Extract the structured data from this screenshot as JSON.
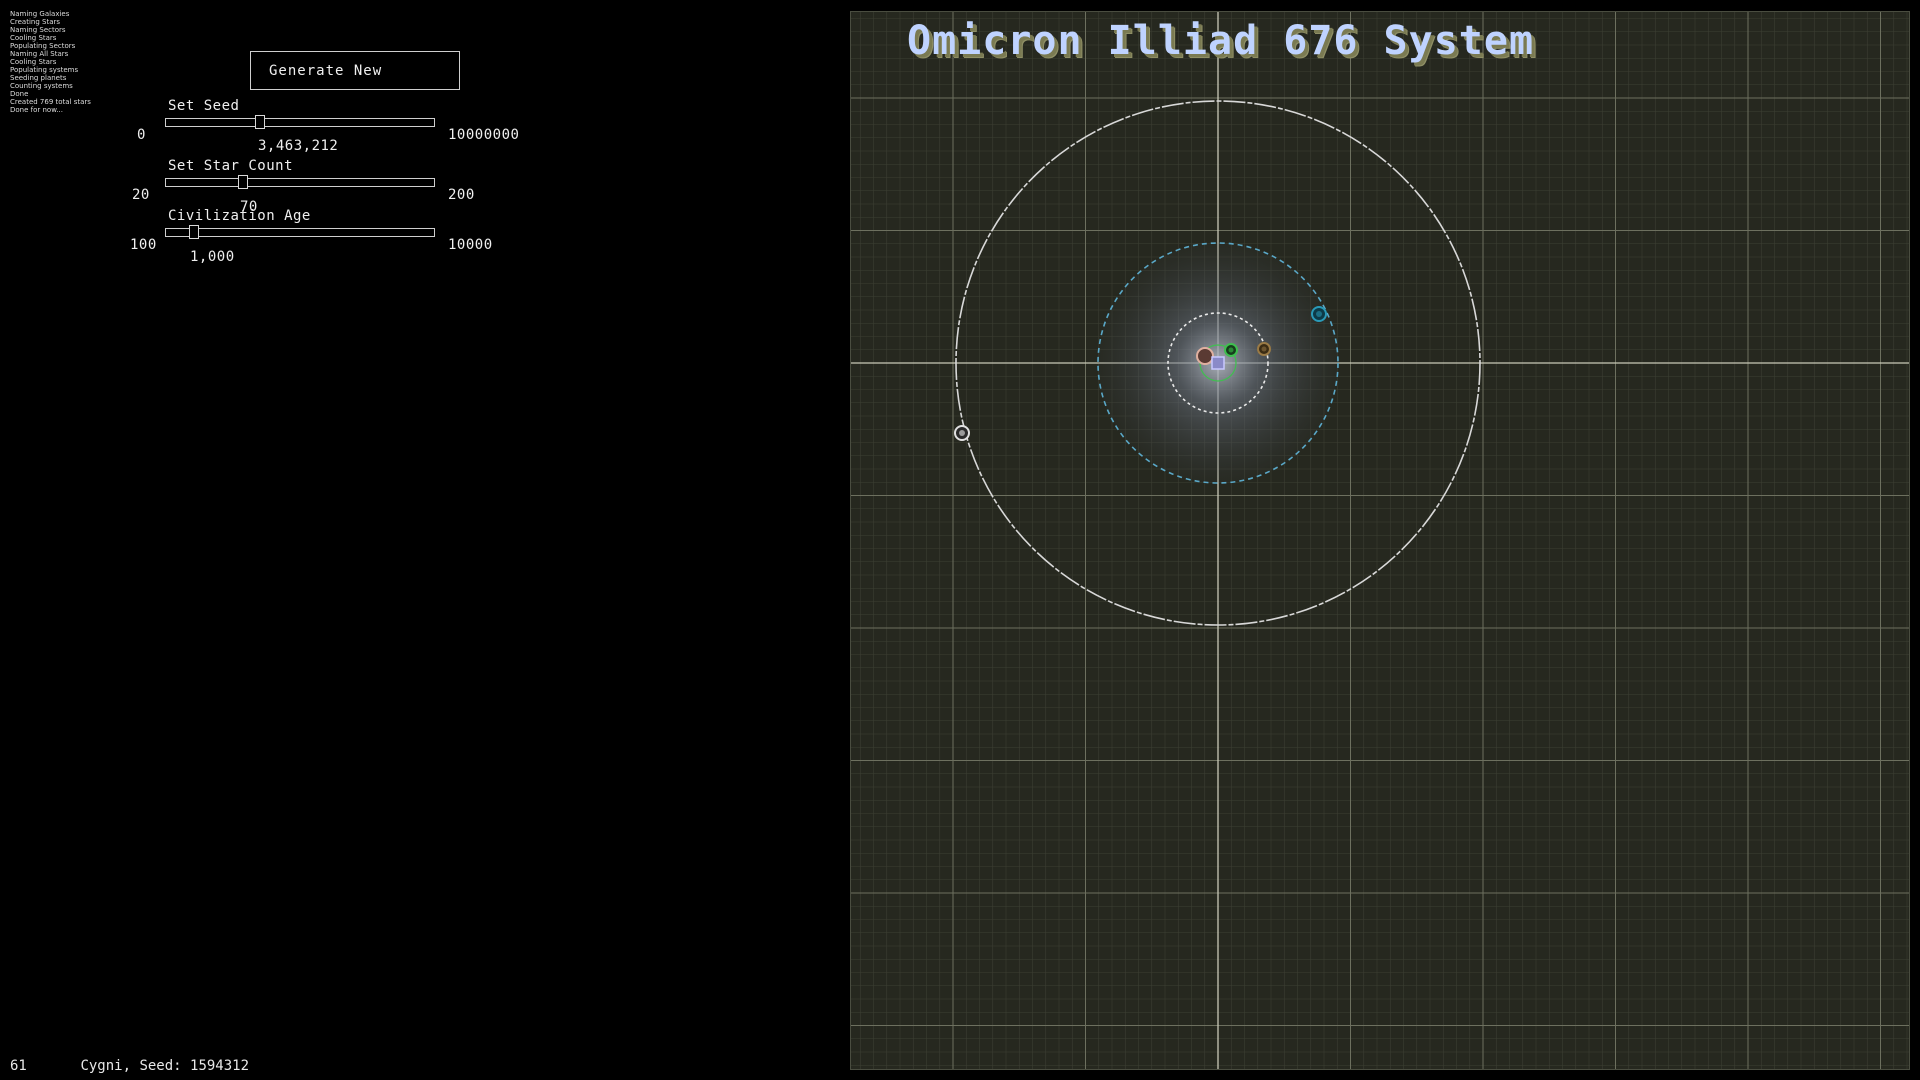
{
  "log": [
    "Naming Galaxies",
    "Creating Stars",
    "Naming Sectors",
    "Cooling Stars",
    "Populating Sectors",
    "Naming All Stars",
    "Cooling Stars",
    "Populating systems",
    "Seeding planets",
    "Counting systems",
    "Done",
    "Created 769 total stars",
    "Done for now..."
  ],
  "generate_button": "Generate New",
  "seed": {
    "label": "Set Seed",
    "min": "0",
    "max": "10000000",
    "value": "3,463,212",
    "fraction": 0.346
  },
  "star_count": {
    "label": "Set Star Count",
    "min": "20",
    "max": "200",
    "value": "70",
    "fraction": 0.278
  },
  "civ_age": {
    "label": "Civilization Age",
    "min": "100",
    "max": "10000",
    "value": "1,000",
    "fraction": 0.091
  },
  "footer": {
    "fps": "61",
    "status": "Cygni, Seed: 1594312"
  },
  "system": {
    "title": "Omicron Illiad 676 System",
    "colors": {
      "background": "#26281f",
      "grid_minor": "#3c3f33",
      "grid_major": "#6d705f",
      "axis": "#c9c9b8",
      "orbit_outer": "#d8d8d8",
      "orbit_teal": "#5aa8c8",
      "orbit_inner": "#eaeaea",
      "planet_teal": "#2a9ab8",
      "planet_green": "#3fbf4f",
      "planet_tan": "#9a7a45",
      "planet_pink": "#e0b0a0",
      "planet_white": "#e0e0e0",
      "star": "#c8c8ff"
    },
    "planets": [
      {
        "name": "planet-white"
      },
      {
        "name": "planet-teal"
      },
      {
        "name": "planet-tan"
      },
      {
        "name": "planet-green"
      },
      {
        "name": "planet-pink"
      }
    ]
  }
}
